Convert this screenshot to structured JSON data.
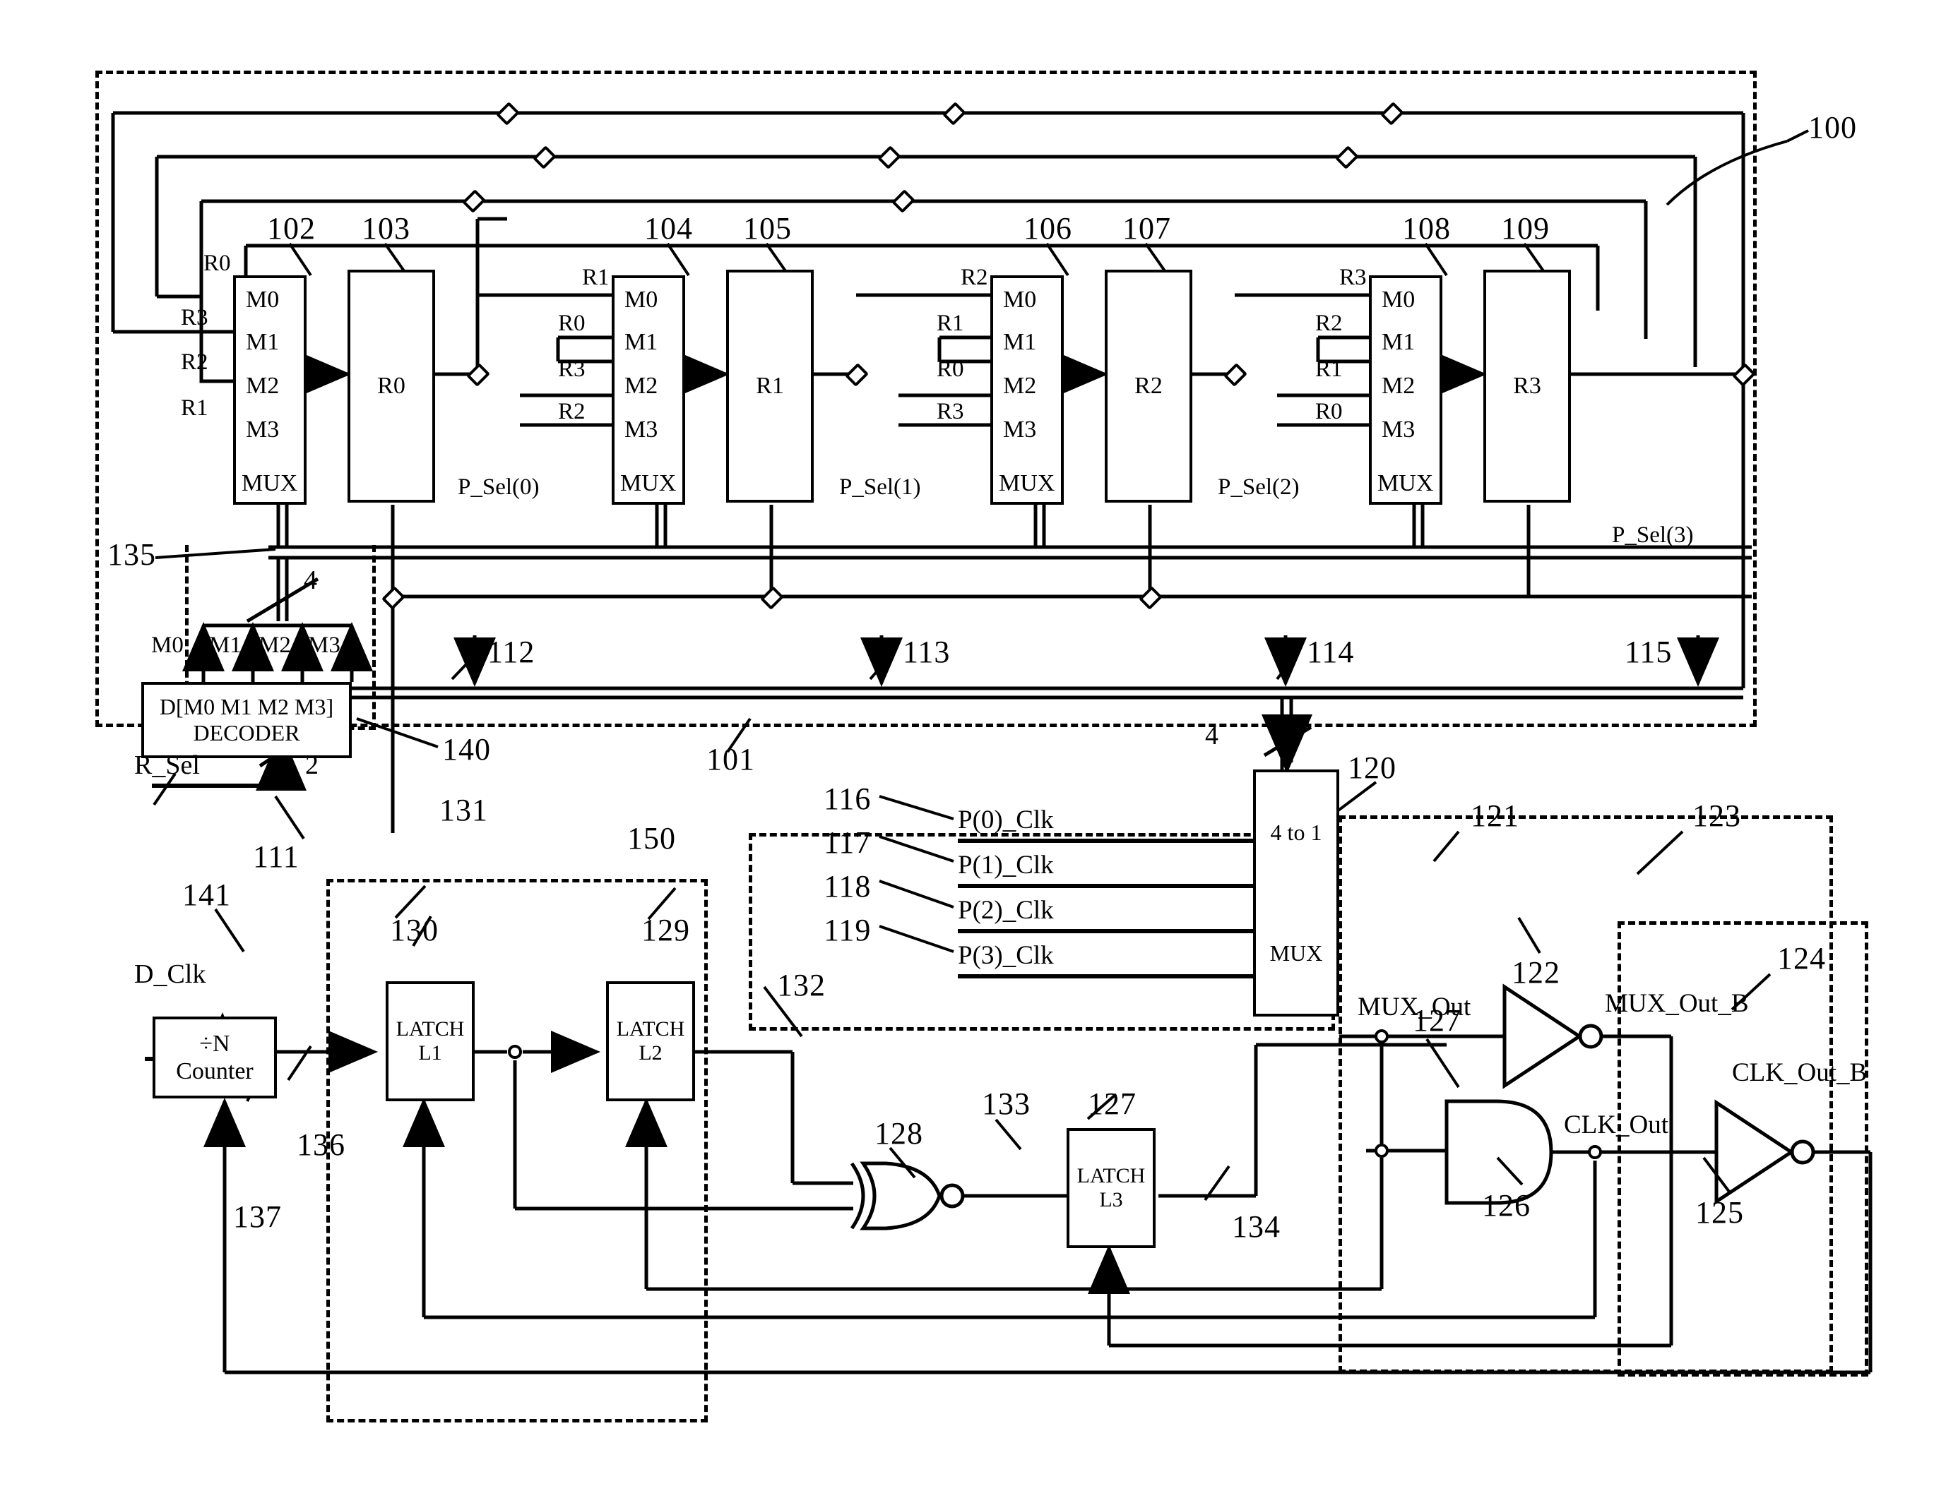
{
  "figure": {
    "ref_100": "100",
    "ref_101": "101",
    "ref_102": "102",
    "ref_103": "103",
    "ref_104": "104",
    "ref_105": "105",
    "ref_106": "106",
    "ref_107": "107",
    "ref_108": "108",
    "ref_109": "109",
    "ref_111": "111",
    "ref_112": "112",
    "ref_113": "113",
    "ref_114": "114",
    "ref_115": "115",
    "ref_116": "116",
    "ref_117": "117",
    "ref_118": "118",
    "ref_119": "119",
    "ref_120": "120",
    "ref_121": "121",
    "ref_122": "122",
    "ref_123": "123",
    "ref_124": "124",
    "ref_125": "125",
    "ref_126": "126",
    "ref_127a": "127",
    "ref_127b": "127",
    "ref_128": "128",
    "ref_129": "129",
    "ref_130": "130",
    "ref_131": "131",
    "ref_132": "132",
    "ref_133": "133",
    "ref_134": "134",
    "ref_135": "135",
    "ref_136": "136",
    "ref_137": "137",
    "ref_140": "140",
    "ref_141": "141",
    "ref_150": "150"
  },
  "mux_stages": [
    {
      "id": "mux0",
      "ports": [
        "M0",
        "M1",
        "M2",
        "M3"
      ],
      "inputs": [
        "R0",
        "R3",
        "R2",
        "R1"
      ],
      "bottom_label": "MUX",
      "register": "R0",
      "psel": "P_Sel(0)"
    },
    {
      "id": "mux1",
      "ports": [
        "M0",
        "M1",
        "M2",
        "M3"
      ],
      "inputs": [
        "R1",
        "R0",
        "R3",
        "R2"
      ],
      "bottom_label": "MUX",
      "register": "R1",
      "psel": "P_Sel(1)"
    },
    {
      "id": "mux2",
      "ports": [
        "M0",
        "M1",
        "M2",
        "M3"
      ],
      "inputs": [
        "R2",
        "R1",
        "R0",
        "R3"
      ],
      "bottom_label": "MUX",
      "register": "R2",
      "psel": "P_Sel(2)"
    },
    {
      "id": "mux3",
      "ports": [
        "M0",
        "M1",
        "M2",
        "M3"
      ],
      "inputs": [
        "R3",
        "R2",
        "R1",
        "R0"
      ],
      "bottom_label": "MUX",
      "register": "R3",
      "psel": "P_Sel(3)"
    }
  ],
  "decoder": {
    "line1": "D[M0 M1 M2 M3]",
    "line2": "DECODER",
    "taps": [
      "M0",
      "M1",
      "M2",
      "M3"
    ],
    "bus_width_top": "4",
    "bus_width_bottom": "2",
    "input_signal": "R_Sel"
  },
  "clock_inputs": {
    "d_clk": "D_Clk",
    "counter_line1": "÷N",
    "counter_line2": "Counter"
  },
  "latches": [
    {
      "line1": "LATCH",
      "line2": "L1"
    },
    {
      "line1": "LATCH",
      "line2": "L2"
    },
    {
      "line1": "LATCH",
      "line2": "L3"
    }
  ],
  "phase_clocks": [
    "P(0)_Clk",
    "P(1)_Clk",
    "P(2)_Clk",
    "P(3)_Clk"
  ],
  "output_mux": {
    "line1": "4 to 1",
    "line2": "MUX",
    "select_bus_width": "4"
  },
  "output_signals": {
    "mux_out": "MUX_Out",
    "mux_out_b": "MUX_Out_B",
    "clk_out": "CLK_Out",
    "clk_out_b": "CLK_Out_B"
  },
  "colors": {
    "ink": "#000000",
    "paper": "#ffffff"
  }
}
